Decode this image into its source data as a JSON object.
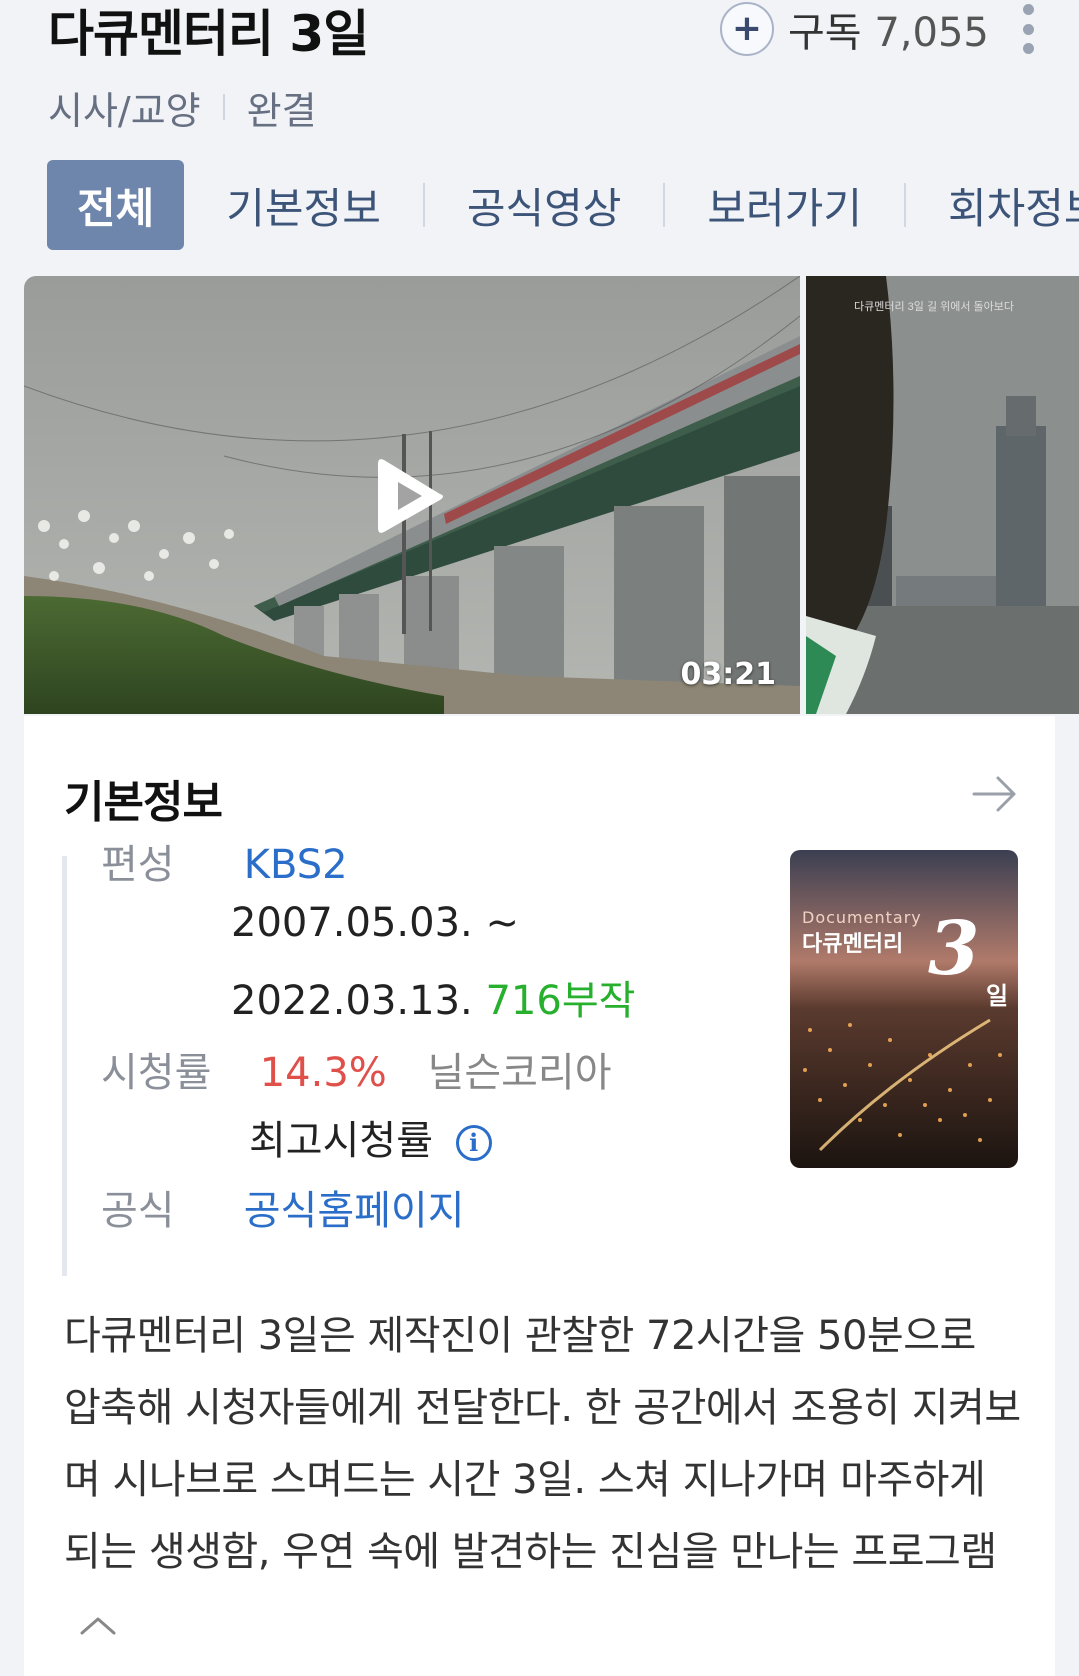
{
  "header": {
    "title": "다큐멘터리 3일",
    "subscribe_label": "구독",
    "subscribe_count": "7,055",
    "genre": "시사/교양",
    "status": "완결"
  },
  "tabs": [
    {
      "label": "전체",
      "active": true
    },
    {
      "label": "기본정보",
      "active": false
    },
    {
      "label": "공식영상",
      "active": false
    },
    {
      "label": "보러가기",
      "active": false
    },
    {
      "label": "회차정보",
      "active": false
    }
  ],
  "video": {
    "duration": "03:21",
    "second_thumb_caption": "다큐멘터리 3일  길 위에서 돌아보다"
  },
  "info": {
    "section_title": "기본정보",
    "broadcast_label": "편성",
    "broadcast_value": "KBS2",
    "period_start": "2007.05.03. ~",
    "period_end": "2022.03.13.",
    "episodes": "716부작",
    "rating_label": "시청률",
    "rating_value": "14.3%",
    "rating_source": "닐슨코리아",
    "rating_note": "최고시청률",
    "official_label": "공식",
    "official_value": "공식홈페이지",
    "poster_en": "Documentary",
    "poster_ko": "다큐멘터리",
    "poster_num": "3",
    "poster_il": "일",
    "description": "다큐멘터리 3일은 제작진이 관찰한 72시간을 50분으로 압축해 시청자들에게 전달한다. 한 공간에서 조용히 지켜보며 시나브로 스며드는 시간 3일. 스쳐 지나가며 마주하게 되는 생생함, 우연 속에 발견하는 진심을 만나는 프로그램"
  },
  "colors": {
    "accent": "#6e86ab",
    "link": "#2b6ec9",
    "green": "#27b02e",
    "red": "#e0504a",
    "background": "#f1f3f7"
  },
  "icons": [
    "plus-icon",
    "more-vertical-icon",
    "play-icon",
    "arrow-right-icon",
    "info-icon",
    "chevron-up-icon"
  ]
}
